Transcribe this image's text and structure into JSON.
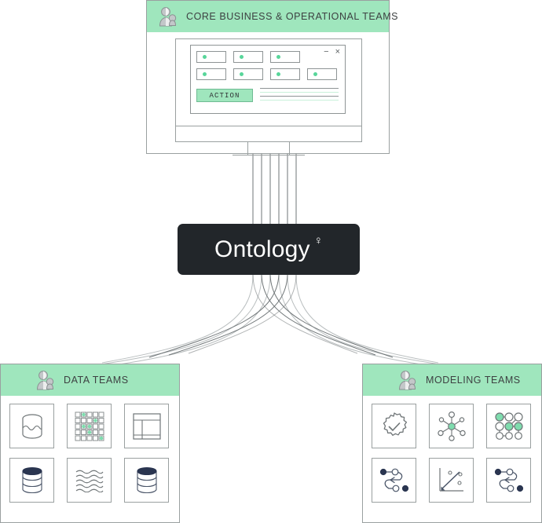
{
  "diagram": {
    "center": {
      "label": "Ontology",
      "superscript": "♀",
      "background": "#22262a",
      "text_color": "#ffffff"
    },
    "accent_green": "#9fe6bd",
    "dot_green": "#58d69a",
    "navy": "#2a3550",
    "border_gray": "#9aa0a0"
  },
  "top_panel": {
    "title": "CORE BUSINESS & OPERATIONAL TEAMS",
    "avatar_icon": "person-icon",
    "window": {
      "minimize_icon": "−",
      "close_icon": "×",
      "action_label": "ACTION",
      "chips_row1": 3,
      "chips_row2": 4,
      "line_count": 4
    }
  },
  "data_panel": {
    "title": "DATA TEAMS",
    "avatar_icon": "person-icon",
    "icons": [
      {
        "name": "database-cylinder-icon"
      },
      {
        "name": "dot-matrix-grid-icon"
      },
      {
        "name": "table-layout-icon"
      },
      {
        "name": "stacked-disks-icon"
      },
      {
        "name": "wave-lines-icon"
      },
      {
        "name": "stacked-disks-alt-icon"
      }
    ]
  },
  "modeling_panel": {
    "title": "MODELING TEAMS",
    "avatar_icon": "person-icon",
    "icons": [
      {
        "name": "gear-check-icon"
      },
      {
        "name": "hub-spoke-network-icon"
      },
      {
        "name": "node-graph-icon"
      },
      {
        "name": "flow-curve-icon"
      },
      {
        "name": "scatter-trend-icon"
      },
      {
        "name": "flow-curve-alt-icon"
      }
    ]
  },
  "connectors": {
    "top_line_count": 6,
    "bottom_curve_count": 6
  }
}
